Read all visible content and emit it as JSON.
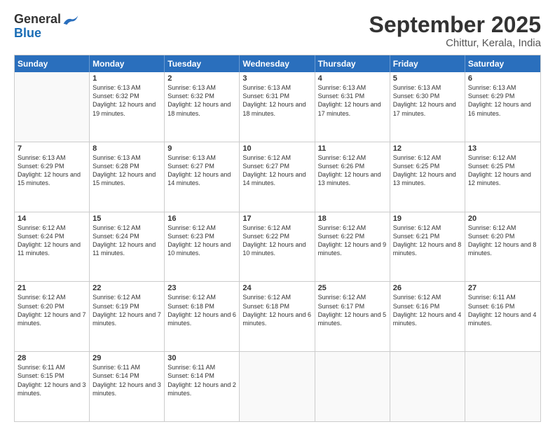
{
  "logo": {
    "general": "General",
    "blue": "Blue"
  },
  "header": {
    "month": "September 2025",
    "location": "Chittur, Kerala, India"
  },
  "days": [
    "Sunday",
    "Monday",
    "Tuesday",
    "Wednesday",
    "Thursday",
    "Friday",
    "Saturday"
  ],
  "weeks": [
    [
      {
        "day": "",
        "empty": true
      },
      {
        "day": "1",
        "sunrise": "Sunrise: 6:13 AM",
        "sunset": "Sunset: 6:32 PM",
        "daylight": "Daylight: 12 hours and 19 minutes."
      },
      {
        "day": "2",
        "sunrise": "Sunrise: 6:13 AM",
        "sunset": "Sunset: 6:32 PM",
        "daylight": "Daylight: 12 hours and 18 minutes."
      },
      {
        "day": "3",
        "sunrise": "Sunrise: 6:13 AM",
        "sunset": "Sunset: 6:31 PM",
        "daylight": "Daylight: 12 hours and 18 minutes."
      },
      {
        "day": "4",
        "sunrise": "Sunrise: 6:13 AM",
        "sunset": "Sunset: 6:31 PM",
        "daylight": "Daylight: 12 hours and 17 minutes."
      },
      {
        "day": "5",
        "sunrise": "Sunrise: 6:13 AM",
        "sunset": "Sunset: 6:30 PM",
        "daylight": "Daylight: 12 hours and 17 minutes."
      },
      {
        "day": "6",
        "sunrise": "Sunrise: 6:13 AM",
        "sunset": "Sunset: 6:29 PM",
        "daylight": "Daylight: 12 hours and 16 minutes."
      }
    ],
    [
      {
        "day": "7",
        "sunrise": "Sunrise: 6:13 AM",
        "sunset": "Sunset: 6:29 PM",
        "daylight": "Daylight: 12 hours and 15 minutes."
      },
      {
        "day": "8",
        "sunrise": "Sunrise: 6:13 AM",
        "sunset": "Sunset: 6:28 PM",
        "daylight": "Daylight: 12 hours and 15 minutes."
      },
      {
        "day": "9",
        "sunrise": "Sunrise: 6:13 AM",
        "sunset": "Sunset: 6:27 PM",
        "daylight": "Daylight: 12 hours and 14 minutes."
      },
      {
        "day": "10",
        "sunrise": "Sunrise: 6:12 AM",
        "sunset": "Sunset: 6:27 PM",
        "daylight": "Daylight: 12 hours and 14 minutes."
      },
      {
        "day": "11",
        "sunrise": "Sunrise: 6:12 AM",
        "sunset": "Sunset: 6:26 PM",
        "daylight": "Daylight: 12 hours and 13 minutes."
      },
      {
        "day": "12",
        "sunrise": "Sunrise: 6:12 AM",
        "sunset": "Sunset: 6:25 PM",
        "daylight": "Daylight: 12 hours and 13 minutes."
      },
      {
        "day": "13",
        "sunrise": "Sunrise: 6:12 AM",
        "sunset": "Sunset: 6:25 PM",
        "daylight": "Daylight: 12 hours and 12 minutes."
      }
    ],
    [
      {
        "day": "14",
        "sunrise": "Sunrise: 6:12 AM",
        "sunset": "Sunset: 6:24 PM",
        "daylight": "Daylight: 12 hours and 11 minutes."
      },
      {
        "day": "15",
        "sunrise": "Sunrise: 6:12 AM",
        "sunset": "Sunset: 6:24 PM",
        "daylight": "Daylight: 12 hours and 11 minutes."
      },
      {
        "day": "16",
        "sunrise": "Sunrise: 6:12 AM",
        "sunset": "Sunset: 6:23 PM",
        "daylight": "Daylight: 12 hours and 10 minutes."
      },
      {
        "day": "17",
        "sunrise": "Sunrise: 6:12 AM",
        "sunset": "Sunset: 6:22 PM",
        "daylight": "Daylight: 12 hours and 10 minutes."
      },
      {
        "day": "18",
        "sunrise": "Sunrise: 6:12 AM",
        "sunset": "Sunset: 6:22 PM",
        "daylight": "Daylight: 12 hours and 9 minutes."
      },
      {
        "day": "19",
        "sunrise": "Sunrise: 6:12 AM",
        "sunset": "Sunset: 6:21 PM",
        "daylight": "Daylight: 12 hours and 8 minutes."
      },
      {
        "day": "20",
        "sunrise": "Sunrise: 6:12 AM",
        "sunset": "Sunset: 6:20 PM",
        "daylight": "Daylight: 12 hours and 8 minutes."
      }
    ],
    [
      {
        "day": "21",
        "sunrise": "Sunrise: 6:12 AM",
        "sunset": "Sunset: 6:20 PM",
        "daylight": "Daylight: 12 hours and 7 minutes."
      },
      {
        "day": "22",
        "sunrise": "Sunrise: 6:12 AM",
        "sunset": "Sunset: 6:19 PM",
        "daylight": "Daylight: 12 hours and 7 minutes."
      },
      {
        "day": "23",
        "sunrise": "Sunrise: 6:12 AM",
        "sunset": "Sunset: 6:18 PM",
        "daylight": "Daylight: 12 hours and 6 minutes."
      },
      {
        "day": "24",
        "sunrise": "Sunrise: 6:12 AM",
        "sunset": "Sunset: 6:18 PM",
        "daylight": "Daylight: 12 hours and 6 minutes."
      },
      {
        "day": "25",
        "sunrise": "Sunrise: 6:12 AM",
        "sunset": "Sunset: 6:17 PM",
        "daylight": "Daylight: 12 hours and 5 minutes."
      },
      {
        "day": "26",
        "sunrise": "Sunrise: 6:12 AM",
        "sunset": "Sunset: 6:16 PM",
        "daylight": "Daylight: 12 hours and 4 minutes."
      },
      {
        "day": "27",
        "sunrise": "Sunrise: 6:11 AM",
        "sunset": "Sunset: 6:16 PM",
        "daylight": "Daylight: 12 hours and 4 minutes."
      }
    ],
    [
      {
        "day": "28",
        "sunrise": "Sunrise: 6:11 AM",
        "sunset": "Sunset: 6:15 PM",
        "daylight": "Daylight: 12 hours and 3 minutes."
      },
      {
        "day": "29",
        "sunrise": "Sunrise: 6:11 AM",
        "sunset": "Sunset: 6:14 PM",
        "daylight": "Daylight: 12 hours and 3 minutes."
      },
      {
        "day": "30",
        "sunrise": "Sunrise: 6:11 AM",
        "sunset": "Sunset: 6:14 PM",
        "daylight": "Daylight: 12 hours and 2 minutes."
      },
      {
        "day": "",
        "empty": true
      },
      {
        "day": "",
        "empty": true
      },
      {
        "day": "",
        "empty": true
      },
      {
        "day": "",
        "empty": true
      }
    ]
  ]
}
